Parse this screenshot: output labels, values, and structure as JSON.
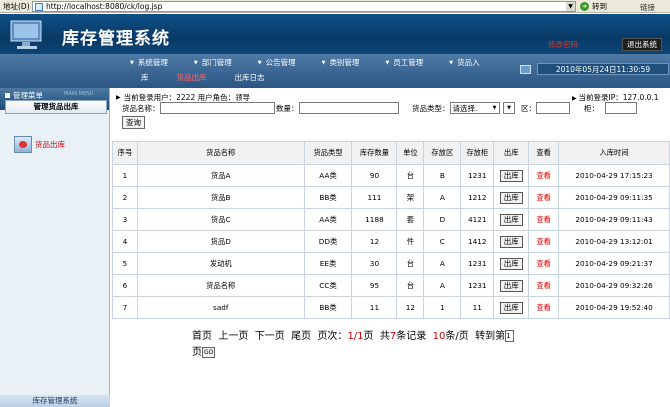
{
  "browser": {
    "address_label": "地址(D)",
    "url": "http://localhost:8080/ck/log.jsp",
    "go_label": "转到",
    "links_label": "链接"
  },
  "header": {
    "title": "库存管理系统",
    "change_password": "修改密码",
    "logout": "退出系统",
    "datetime": "2010年05月24日11:30:59"
  },
  "menu": {
    "row1": [
      "系统管理",
      "部门管理",
      "公告管理",
      "类别管理",
      "员工管理",
      "货品入"
    ],
    "row2": [
      "库",
      "货品出库",
      "出库日志"
    ],
    "active": "货品出库"
  },
  "sidebar": {
    "heading": "管理菜单",
    "heading_en": "MAIN MENU",
    "section_title": "管理货品出库",
    "item_label": "货品出库",
    "footer": "库存管理系统"
  },
  "user_info": {
    "left": "当前登录用户：2222  用户角色：领导",
    "right": "当前登录IP：127.0.0.1"
  },
  "search": {
    "name_label": "货品名称：",
    "qty_label": "数量：",
    "type_label": "货品类型：",
    "type_value": "请选择.",
    "area_label": "区：",
    "cabinet_label": "柜：",
    "query_button": "查询"
  },
  "table": {
    "headers": [
      "序号",
      "货品名称",
      "货品类型",
      "库存数量",
      "单位",
      "存放区",
      "存放柜",
      "出库",
      "查看",
      "入库时间"
    ],
    "out_label": "出库",
    "view_label": "查看",
    "rows": [
      [
        "1",
        "货品A",
        "AA类",
        "90",
        "台",
        "B",
        "1231",
        "2010-04-29 17:15:23"
      ],
      [
        "2",
        "货品B",
        "BB类",
        "111",
        "架",
        "A",
        "1212",
        "2010-04-29 09:11:35"
      ],
      [
        "3",
        "货品C",
        "AA类",
        "1188",
        "套",
        "D",
        "4121",
        "2010-04-29 09:11:43"
      ],
      [
        "4",
        "货品D",
        "DD类",
        "12",
        "件",
        "C",
        "1412",
        "2010-04-29 13:12:01"
      ],
      [
        "5",
        "发动机",
        "EE类",
        "30",
        "台",
        "A",
        "1231",
        "2010-04-29 09:21:37"
      ],
      [
        "6",
        "货品名称",
        "CC类",
        "95",
        "台",
        "A",
        "1231",
        "2010-04-29 09:32:26"
      ],
      [
        "7",
        "sadf",
        "BB类",
        "11",
        "12",
        "1",
        "11",
        "2010-04-29 19:52:40"
      ]
    ]
  },
  "pager": {
    "first": "首页",
    "prev": "上一页",
    "next": "下一页",
    "last": "尾页",
    "page_prefix": "页次：",
    "page_current": "1/1",
    "page_suffix": "页",
    "total_prefix": "共",
    "total_count": "7",
    "total_suffix": "条记录",
    "per_page_count": "10",
    "per_page_suffix": "条/页",
    "goto_label": "转到第",
    "goto_value": "1",
    "goto_suffix": "页",
    "go_button": "GO"
  }
}
